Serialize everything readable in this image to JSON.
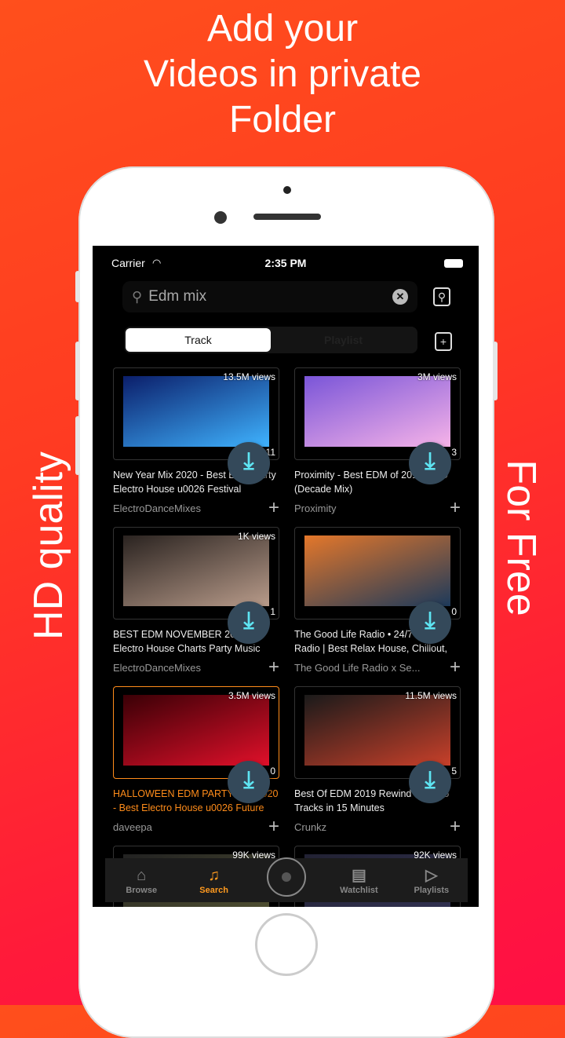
{
  "promo": {
    "headline": [
      "Add your",
      "Videos in private",
      "Folder"
    ],
    "left_text": "HD quality",
    "right_text": "For Free"
  },
  "status": {
    "carrier": "Carrier",
    "time": "2:35 PM"
  },
  "search": {
    "value": "Edm mix"
  },
  "segment": {
    "track": "Track",
    "playlist": "Playlist"
  },
  "videos": [
    {
      "views": "13.5M views",
      "duration": "11",
      "title": "New Year Mix 2020 - Best EDM Party Electro House u0026 Festival",
      "channel": "ElectroDanceMixes",
      "colors": [
        "#0b1e6a",
        "#3fb3ff"
      ]
    },
    {
      "views": "3M views",
      "duration": "3",
      "title": "Proximity - Best EDM of 2010-2019 (Decade Mix)",
      "channel": "Proximity",
      "colors": [
        "#7a55d8",
        "#f6b3e8"
      ]
    },
    {
      "views": "1K views",
      "duration": "1",
      "title": "BEST EDM NOVEMBER 2020 🔷 Electro House Charts Party Music",
      "channel": "ElectroDanceMixes",
      "colors": [
        "#2a2320",
        "#b89b8a"
      ]
    },
    {
      "views": "",
      "duration": "0",
      "title": "The Good Life Radio • 24/7 Live Radio | Best Relax House, Chillout,",
      "channel": "The Good Life Radio x Se...",
      "colors": [
        "#e4772a",
        "#1d3a5b"
      ]
    },
    {
      "views": "3.5M views",
      "duration": "0",
      "title": "HALLOWEEN EDM PARTY MIX 2020 - Best Electro House u0026 Future",
      "channel": "daveepa",
      "colors": [
        "#3a0006",
        "#e0102a"
      ],
      "active": true
    },
    {
      "views": "11.5M views",
      "duration": "5",
      "title": "Best Of EDM 2019 Rewind Mix - 65 Tracks in 15 Minutes",
      "channel": "Crunkz",
      "colors": [
        "#1a1a1a",
        "#c8402a"
      ]
    },
    {
      "views": "99K views",
      "duration": "",
      "title": "",
      "channel": "",
      "colors": [
        "#222",
        "#553"
      ]
    },
    {
      "views": "92K views",
      "duration": "",
      "title": "",
      "channel": "",
      "colors": [
        "#223",
        "#335"
      ]
    }
  ],
  "tabs": [
    {
      "label": "Browse",
      "icon": "home-icon"
    },
    {
      "label": "Search",
      "icon": "search-music-icon",
      "active": true
    },
    {
      "label": "",
      "icon": "now-playing-disc-icon"
    },
    {
      "label": "Watchlist",
      "icon": "clipboard-icon"
    },
    {
      "label": "Playlists",
      "icon": "playlist-icon"
    }
  ],
  "colors": {
    "accent": "#ff9a1f",
    "download": "#5ee4f2"
  }
}
